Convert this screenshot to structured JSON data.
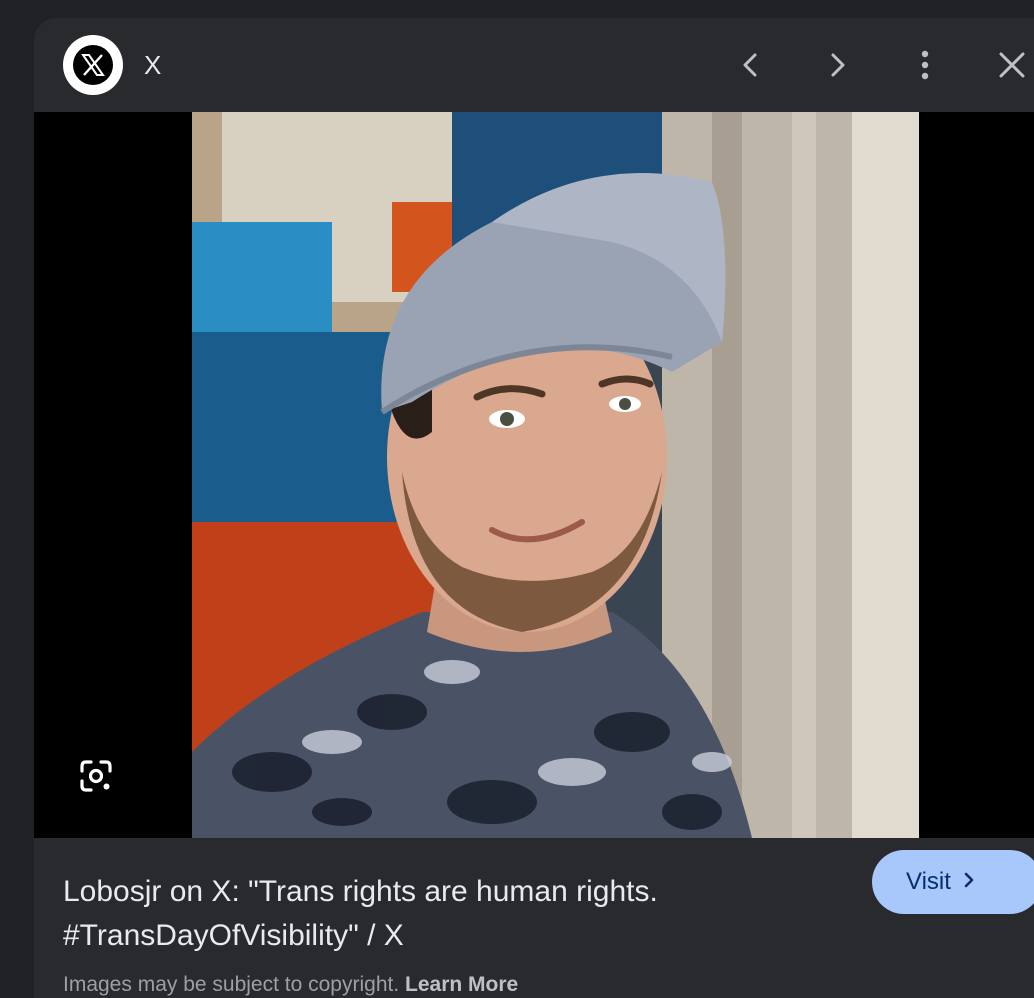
{
  "header": {
    "site_name": "X",
    "logo_icon": "x-logo-icon",
    "prev_icon": "chevron-left-icon",
    "next_icon": "chevron-right-icon",
    "more_icon": "more-vert-icon",
    "close_icon": "close-icon"
  },
  "image": {
    "lens_icon": "google-lens-icon"
  },
  "result": {
    "title_line1": "Lobosjr on X: \"Trans rights are human rights.",
    "title_line2": "#TransDayOfVisibility\" / X",
    "visit_label": "Visit"
  },
  "footer": {
    "copyright_text": "Images may be subject to copyright.",
    "learn_more": "Learn More"
  },
  "colors": {
    "panel_bg": "#292a2d",
    "page_bg": "#202124",
    "visit_bg": "#a8c7fa",
    "visit_text": "#062e6f",
    "text_primary": "#e8eaed",
    "text_secondary": "#9aa0a6"
  }
}
